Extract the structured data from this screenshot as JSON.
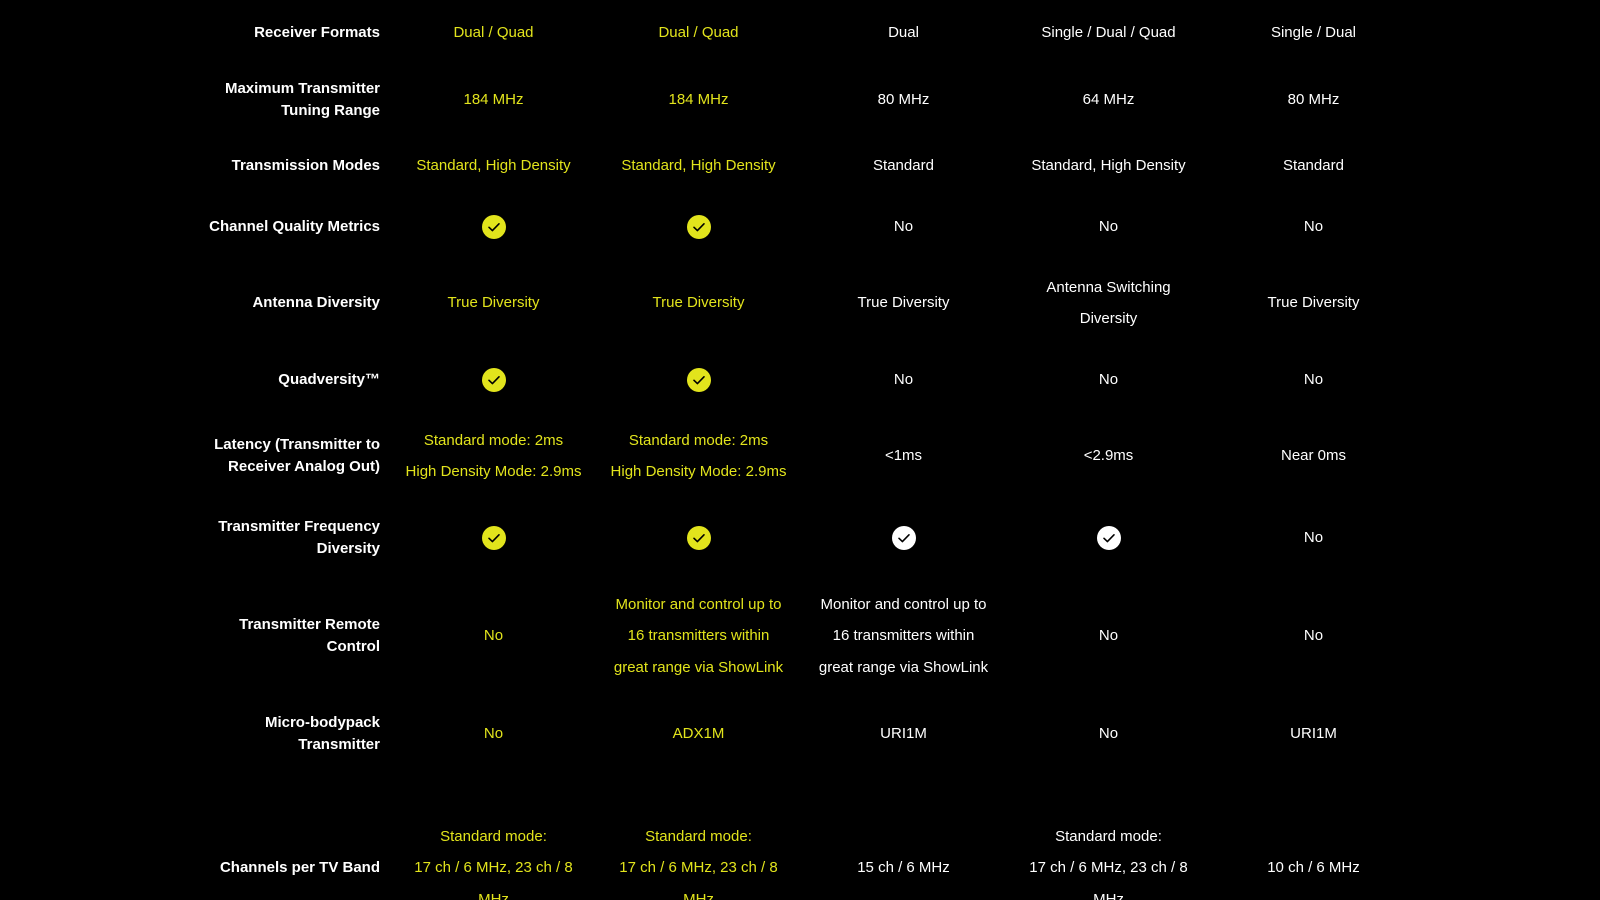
{
  "colors": {
    "background": "#000000",
    "accent": "#e2e41c",
    "text": "#ffffff"
  },
  "rows": [
    {
      "label": [
        "Receiver Formats"
      ],
      "cells": [
        {
          "type": "text",
          "color": "yellow",
          "lines": [
            "Dual / Quad"
          ]
        },
        {
          "type": "text",
          "color": "yellow",
          "lines": [
            "Dual / Quad"
          ]
        },
        {
          "type": "text",
          "color": "white",
          "lines": [
            "Dual"
          ]
        },
        {
          "type": "text",
          "color": "white",
          "lines": [
            "Single / Dual / Quad"
          ]
        },
        {
          "type": "text",
          "color": "white",
          "lines": [
            "Single / Dual"
          ]
        }
      ]
    },
    {
      "label": [
        "Maximum Transmitter",
        "Tuning Range"
      ],
      "cells": [
        {
          "type": "text",
          "color": "yellow",
          "lines": [
            "184 MHz"
          ]
        },
        {
          "type": "text",
          "color": "yellow",
          "lines": [
            "184 MHz"
          ]
        },
        {
          "type": "text",
          "color": "white",
          "lines": [
            "80 MHz"
          ]
        },
        {
          "type": "text",
          "color": "white",
          "lines": [
            "64 MHz"
          ]
        },
        {
          "type": "text",
          "color": "white",
          "lines": [
            "80 MHz"
          ]
        }
      ]
    },
    {
      "label": [
        "Transmission Modes"
      ],
      "cells": [
        {
          "type": "text",
          "color": "yellow",
          "lines": [
            "Standard, High Density"
          ]
        },
        {
          "type": "text",
          "color": "yellow",
          "lines": [
            "Standard, High Density"
          ]
        },
        {
          "type": "text",
          "color": "white",
          "lines": [
            "Standard"
          ]
        },
        {
          "type": "text",
          "color": "white",
          "lines": [
            "Standard, High Density"
          ]
        },
        {
          "type": "text",
          "color": "white",
          "lines": [
            "Standard"
          ]
        }
      ]
    },
    {
      "label": [
        "Channel Quality Metrics"
      ],
      "cells": [
        {
          "type": "check",
          "color": "yellow",
          "icon": "check-circle-icon"
        },
        {
          "type": "check",
          "color": "yellow",
          "icon": "check-circle-icon"
        },
        {
          "type": "text",
          "color": "white",
          "lines": [
            "No"
          ]
        },
        {
          "type": "text",
          "color": "white",
          "lines": [
            "No"
          ]
        },
        {
          "type": "text",
          "color": "white",
          "lines": [
            "No"
          ]
        }
      ]
    },
    {
      "label": [
        "Antenna Diversity"
      ],
      "cells": [
        {
          "type": "text",
          "color": "yellow",
          "lines": [
            "True Diversity"
          ]
        },
        {
          "type": "text",
          "color": "yellow",
          "lines": [
            "True Diversity"
          ]
        },
        {
          "type": "text",
          "color": "white",
          "lines": [
            "True Diversity"
          ]
        },
        {
          "type": "text",
          "color": "white",
          "lines": [
            "Antenna Switching",
            "Diversity"
          ]
        },
        {
          "type": "text",
          "color": "white",
          "lines": [
            "True Diversity"
          ]
        }
      ]
    },
    {
      "label": [
        "Quadversity™"
      ],
      "cells": [
        {
          "type": "check",
          "color": "yellow",
          "icon": "check-circle-icon"
        },
        {
          "type": "check",
          "color": "yellow",
          "icon": "check-circle-icon"
        },
        {
          "type": "text",
          "color": "white",
          "lines": [
            "No"
          ]
        },
        {
          "type": "text",
          "color": "white",
          "lines": [
            "No"
          ]
        },
        {
          "type": "text",
          "color": "white",
          "lines": [
            "No"
          ]
        }
      ]
    },
    {
      "label": [
        "Latency (Transmitter to",
        "Receiver Analog Out)"
      ],
      "cells": [
        {
          "type": "text",
          "color": "yellow",
          "lines": [
            "Standard mode: 2ms",
            "High Density Mode: 2.9ms"
          ]
        },
        {
          "type": "text",
          "color": "yellow",
          "lines": [
            "Standard mode: 2ms",
            "High Density Mode: 2.9ms"
          ]
        },
        {
          "type": "text",
          "color": "white",
          "lines": [
            "<1ms"
          ]
        },
        {
          "type": "text",
          "color": "white",
          "lines": [
            "<2.9ms"
          ]
        },
        {
          "type": "text",
          "color": "white",
          "lines": [
            "Near 0ms"
          ]
        }
      ]
    },
    {
      "label": [
        "Transmitter Frequency",
        "Diversity"
      ],
      "cells": [
        {
          "type": "check",
          "color": "yellow",
          "icon": "check-circle-icon"
        },
        {
          "type": "check",
          "color": "yellow",
          "icon": "check-circle-icon"
        },
        {
          "type": "check",
          "color": "white",
          "icon": "check-circle-icon"
        },
        {
          "type": "check",
          "color": "white",
          "icon": "check-circle-icon"
        },
        {
          "type": "text",
          "color": "white",
          "lines": [
            "No"
          ]
        }
      ]
    },
    {
      "label": [
        "Transmitter Remote",
        "Control"
      ],
      "cells": [
        {
          "type": "text",
          "color": "yellow",
          "lines": [
            "No"
          ]
        },
        {
          "type": "text",
          "color": "yellow",
          "lines": [
            "Monitor and control up to",
            "16 transmitters within",
            "great range via ShowLink"
          ]
        },
        {
          "type": "text",
          "color": "white",
          "lines": [
            "Monitor and control up to",
            "16 transmitters within",
            "great range via ShowLink"
          ]
        },
        {
          "type": "text",
          "color": "white",
          "lines": [
            "No"
          ]
        },
        {
          "type": "text",
          "color": "white",
          "lines": [
            "No"
          ]
        }
      ]
    },
    {
      "label": [
        "Micro-bodypack",
        "Transmitter"
      ],
      "cells": [
        {
          "type": "text",
          "color": "yellow",
          "lines": [
            "No"
          ]
        },
        {
          "type": "text",
          "color": "yellow",
          "lines": [
            "ADX1M"
          ]
        },
        {
          "type": "text",
          "color": "white",
          "lines": [
            "URI1M"
          ]
        },
        {
          "type": "text",
          "color": "white",
          "lines": [
            "No"
          ]
        },
        {
          "type": "text",
          "color": "white",
          "lines": [
            "URI1M"
          ]
        }
      ]
    },
    {
      "label": [
        "Channels per TV Band"
      ],
      "cells": [
        {
          "type": "text",
          "color": "yellow",
          "lines": [
            "Standard mode:",
            "17 ch / 6 MHz, 23 ch / 8",
            "MHz"
          ]
        },
        {
          "type": "text",
          "color": "yellow",
          "lines": [
            "Standard mode:",
            "17 ch / 6 MHz, 23 ch / 8",
            "MHz"
          ]
        },
        {
          "type": "text",
          "color": "white",
          "lines": [
            "15 ch / 6 MHz"
          ]
        },
        {
          "type": "text",
          "color": "white",
          "lines": [
            "Standard mode:",
            "17 ch / 6 MHz, 23 ch / 8",
            "MHz"
          ]
        },
        {
          "type": "text",
          "color": "white",
          "lines": [
            "10 ch / 6 MHz"
          ]
        }
      ]
    }
  ]
}
